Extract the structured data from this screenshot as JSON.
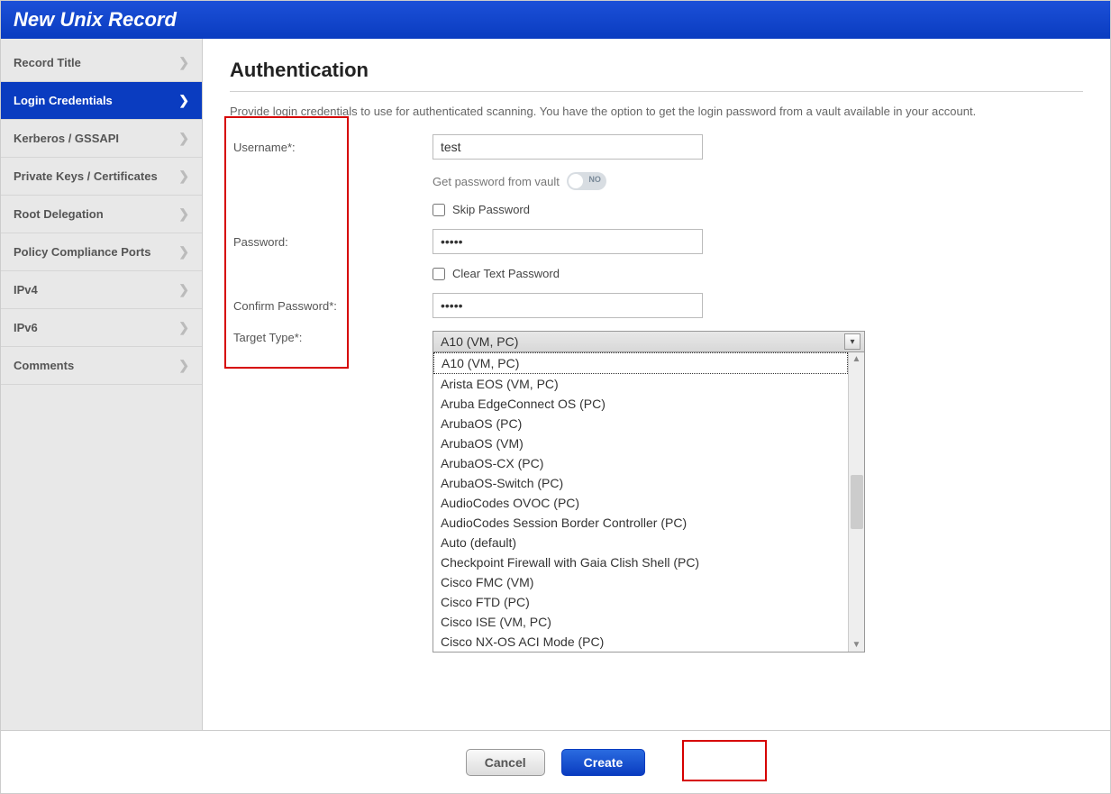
{
  "header": {
    "title": "New Unix Record"
  },
  "sidebar": {
    "items": [
      {
        "label": "Record Title"
      },
      {
        "label": "Login Credentials"
      },
      {
        "label": "Kerberos / GSSAPI"
      },
      {
        "label": "Private Keys / Certificates"
      },
      {
        "label": "Root Delegation"
      },
      {
        "label": "Policy Compliance Ports"
      },
      {
        "label": "IPv4"
      },
      {
        "label": "IPv6"
      },
      {
        "label": "Comments"
      }
    ]
  },
  "main": {
    "title": "Authentication",
    "intro": "Provide login credentials to use for authenticated scanning. You have the option to get the login password from a vault available in your account.",
    "labels": {
      "username": "Username*:",
      "vault": "Get password from vault",
      "vault_state": "NO",
      "skip": "Skip Password",
      "password": "Password:",
      "clear": "Clear Text Password",
      "confirm": "Confirm Password*:",
      "target": "Target Type*:"
    },
    "values": {
      "username": "test",
      "password": "•••••",
      "confirm": "•••••",
      "target_selected": "A10 (VM, PC)"
    },
    "target_options": [
      "A10 (VM, PC)",
      "Arista EOS (VM, PC)",
      "Aruba EdgeConnect OS (PC)",
      "ArubaOS (PC)",
      "ArubaOS (VM)",
      "ArubaOS-CX (PC)",
      "ArubaOS-Switch (PC)",
      "AudioCodes OVOC (PC)",
      "AudioCodes Session Border Controller (PC)",
      "Auto (default)",
      "Checkpoint Firewall with Gaia Clish Shell (PC)",
      "Cisco FMC (VM)",
      "Cisco FTD (PC)",
      "Cisco ISE (VM, PC)",
      "Cisco NX-OS ACI Mode (PC)"
    ]
  },
  "footer": {
    "cancel": "Cancel",
    "create": "Create"
  }
}
